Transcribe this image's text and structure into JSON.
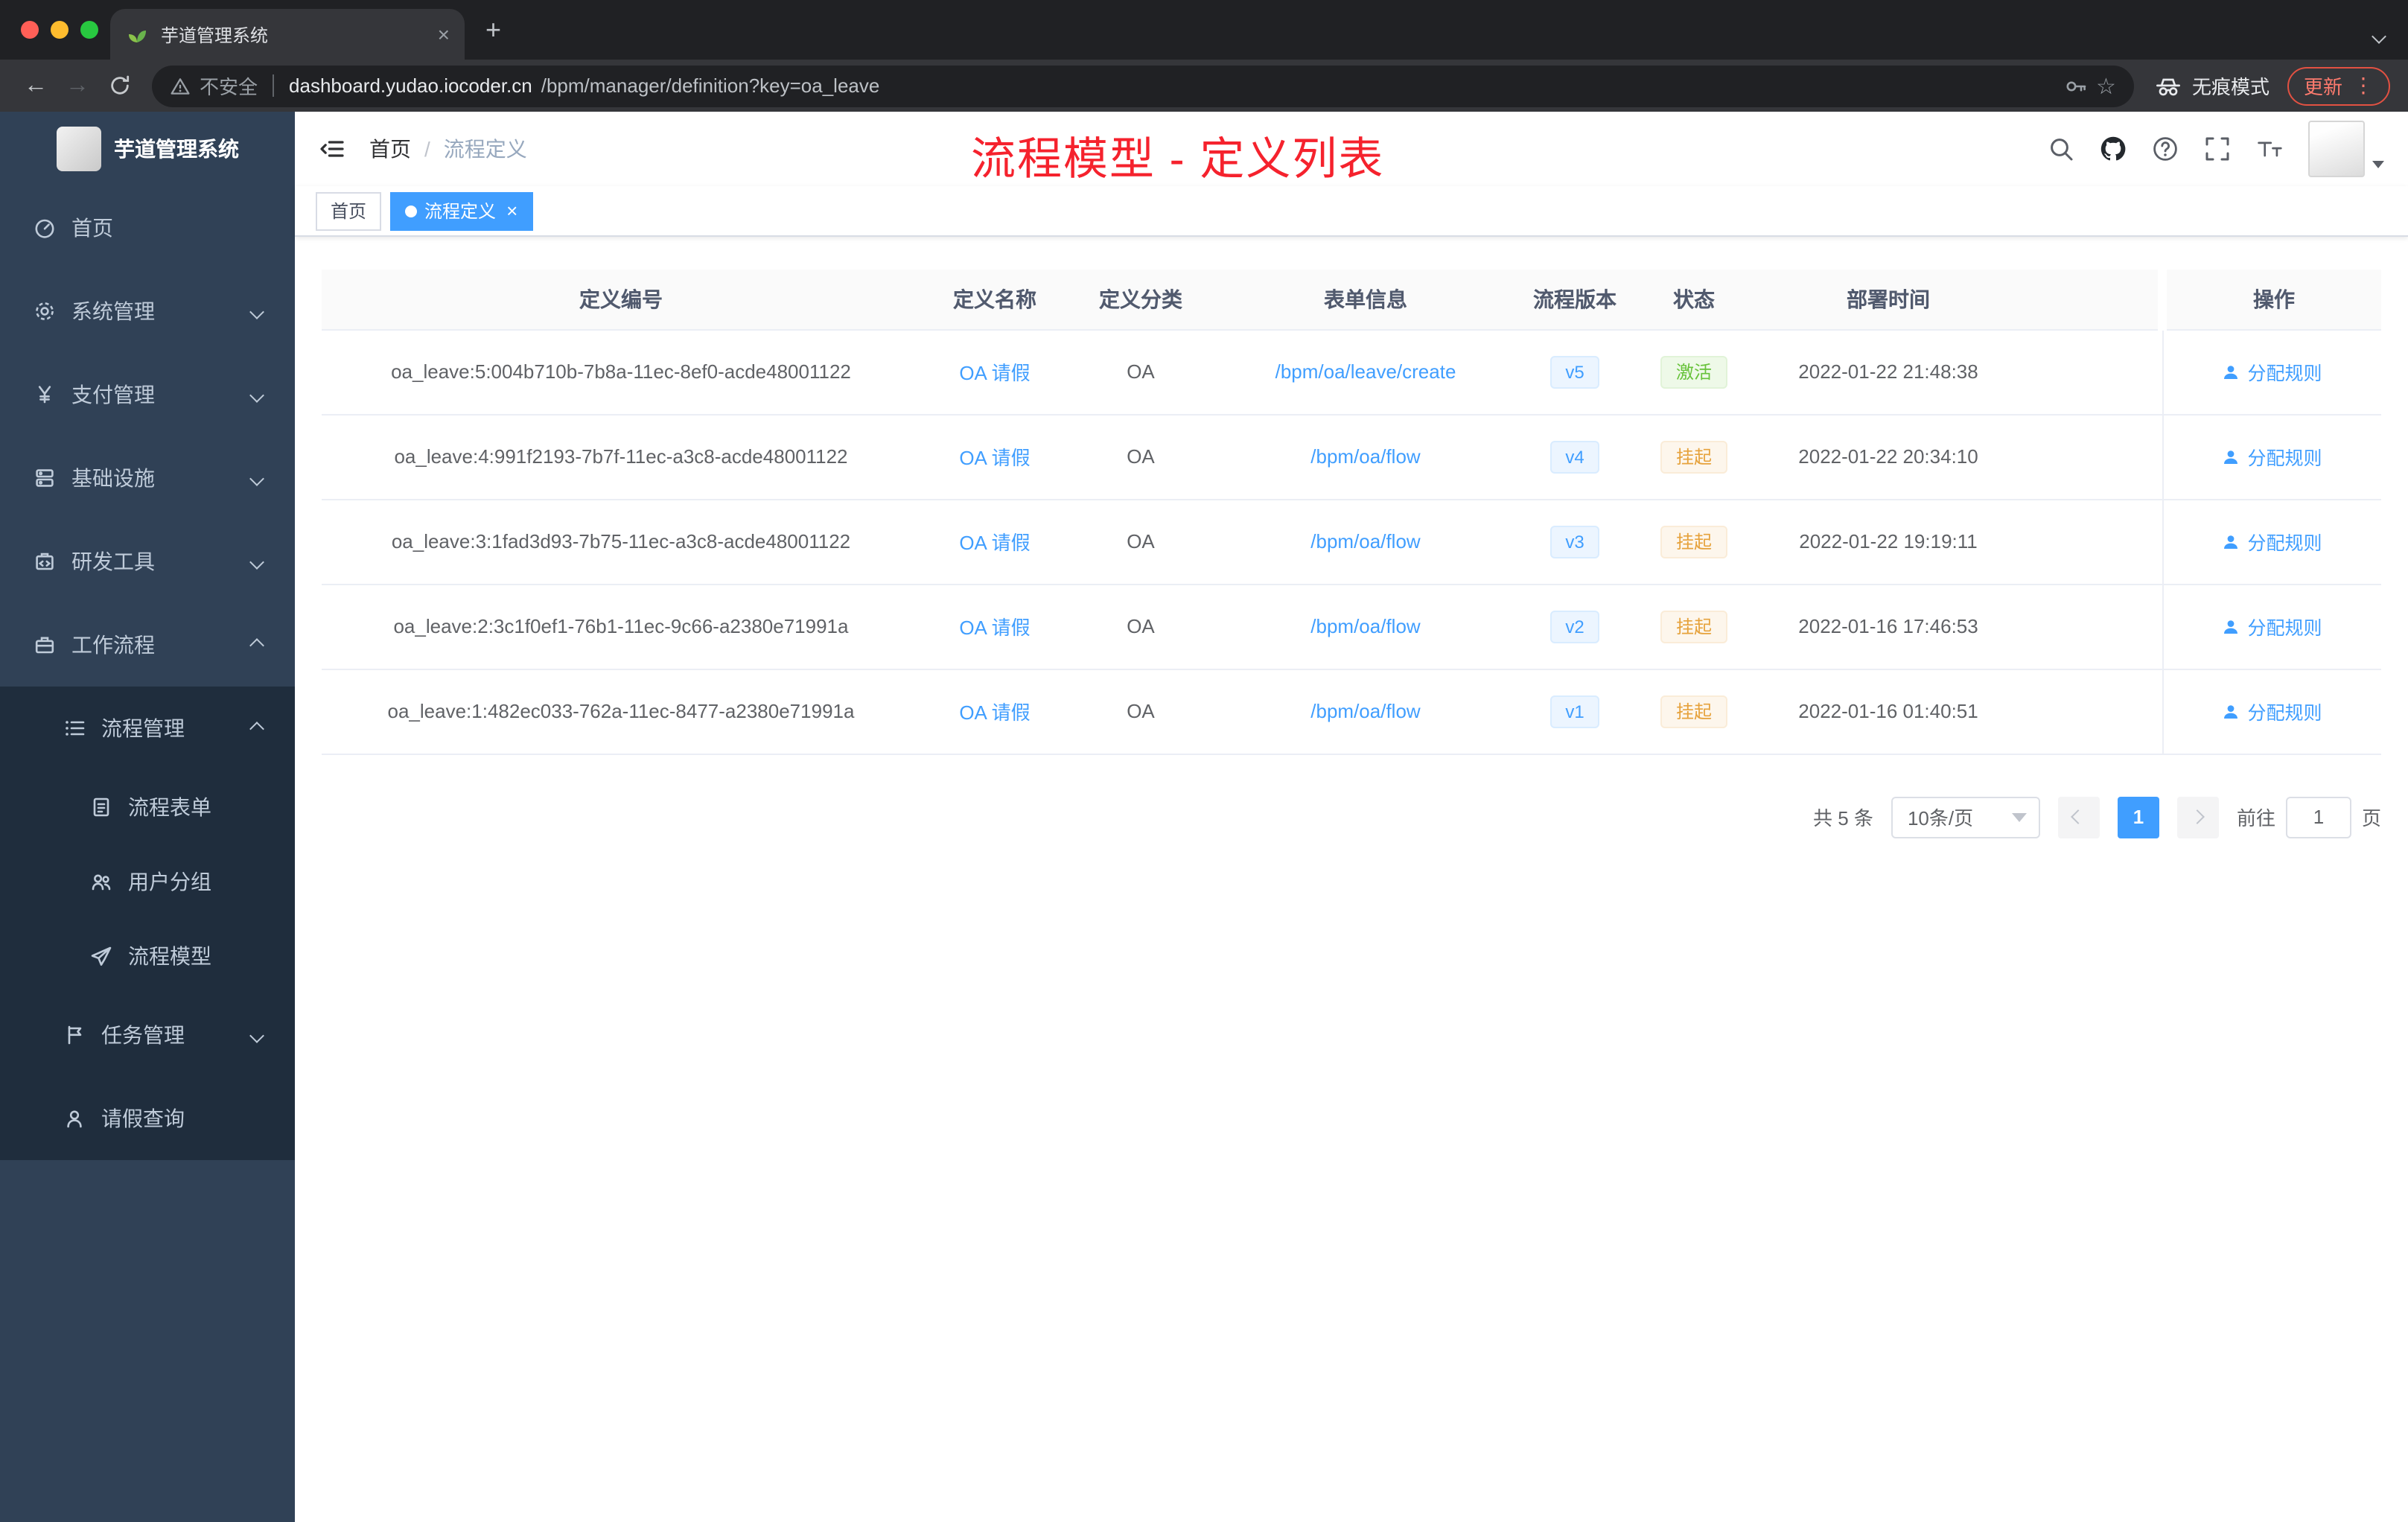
{
  "browser": {
    "tab_title": "芋道管理系统",
    "url_security": "不安全",
    "url_host": "dashboard.yudao.iocoder.cn",
    "url_path": "/bpm/manager/definition?key=oa_leave",
    "incognito_label": "无痕模式",
    "update_label": "更新"
  },
  "icons": {
    "close": "×",
    "plus": "+",
    "back": "←",
    "forward": "→",
    "dots": "⋮",
    "star": "☆"
  },
  "annotation": "流程模型 - 定义列表",
  "colors": {
    "primary": "#409eff",
    "sidebar_bg": "#304156",
    "submenu_bg": "#1f2d3d",
    "annotation_red": "#f5222d",
    "status_active_green": "#67c23a",
    "status_suspend_orange": "#e6a23c"
  },
  "sidebar": {
    "app_title": "芋道管理系统",
    "items": [
      {
        "label": "首页"
      },
      {
        "label": "系统管理"
      },
      {
        "label": "支付管理"
      },
      {
        "label": "基础设施"
      },
      {
        "label": "研发工具"
      },
      {
        "label": "工作流程"
      }
    ],
    "workflow_menu": {
      "process_management": {
        "label": "流程管理",
        "children": [
          {
            "label": "流程表单"
          },
          {
            "label": "用户分组"
          },
          {
            "label": "流程模型"
          }
        ]
      },
      "task_management": {
        "label": "任务管理"
      },
      "leave_query": {
        "label": "请假查询"
      }
    }
  },
  "header": {
    "breadcrumb_home": "首页",
    "breadcrumb_separator": "/",
    "breadcrumb_current": "流程定义"
  },
  "tags": [
    {
      "label": "首页"
    },
    {
      "label": "流程定义"
    }
  ],
  "table": {
    "columns": [
      "定义编号",
      "定义名称",
      "定义分类",
      "表单信息",
      "流程版本",
      "状态",
      "部署时间",
      "",
      "操作"
    ],
    "rows": [
      {
        "id": "oa_leave:5:004b710b-7b8a-11ec-8ef0-acde48001122",
        "name": "OA 请假",
        "category": "OA",
        "form": "/bpm/oa/leave/create",
        "version": "v5",
        "status": "激活",
        "time": "2022-01-22 21:48:38",
        "action": "分配规则"
      },
      {
        "id": "oa_leave:4:991f2193-7b7f-11ec-a3c8-acde48001122",
        "name": "OA 请假",
        "category": "OA",
        "form": "/bpm/oa/flow",
        "version": "v4",
        "status": "挂起",
        "time": "2022-01-22 20:34:10",
        "action": "分配规则"
      },
      {
        "id": "oa_leave:3:1fad3d93-7b75-11ec-a3c8-acde48001122",
        "name": "OA 请假",
        "category": "OA",
        "form": "/bpm/oa/flow",
        "version": "v3",
        "status": "挂起",
        "time": "2022-01-22 19:19:11",
        "action": "分配规则"
      },
      {
        "id": "oa_leave:2:3c1f0ef1-76b1-11ec-9c66-a2380e71991a",
        "name": "OA 请假",
        "category": "OA",
        "form": "/bpm/oa/flow",
        "version": "v2",
        "status": "挂起",
        "time": "2022-01-16 17:46:53",
        "action": "分配规则"
      },
      {
        "id": "oa_leave:1:482ec033-762a-11ec-8477-a2380e71991a",
        "name": "OA 请假",
        "category": "OA",
        "form": "/bpm/oa/flow",
        "version": "v1",
        "status": "挂起",
        "time": "2022-01-16 01:40:51",
        "action": "分配规则"
      }
    ]
  },
  "pagination": {
    "total": "共 5 条",
    "page_size": "10条/页",
    "page": "1",
    "goto_label": "前往",
    "goto_value": "1",
    "goto_unit": "页"
  }
}
